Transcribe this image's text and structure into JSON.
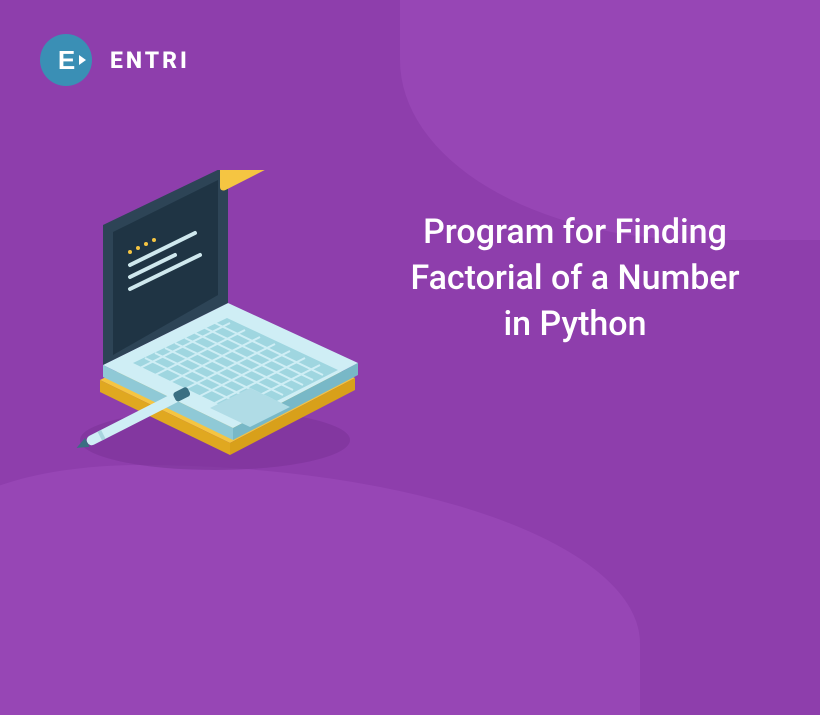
{
  "logo": {
    "glyph": "E",
    "brand": "ENTRI"
  },
  "headline": {
    "line1": "Program for Finding",
    "line2": "Factorial of a Number",
    "line3": "in Python"
  },
  "colors": {
    "background": "#8e3eac",
    "wave": "#9746b5",
    "logo_circle": "#3a8fb5",
    "text": "#ffffff"
  }
}
